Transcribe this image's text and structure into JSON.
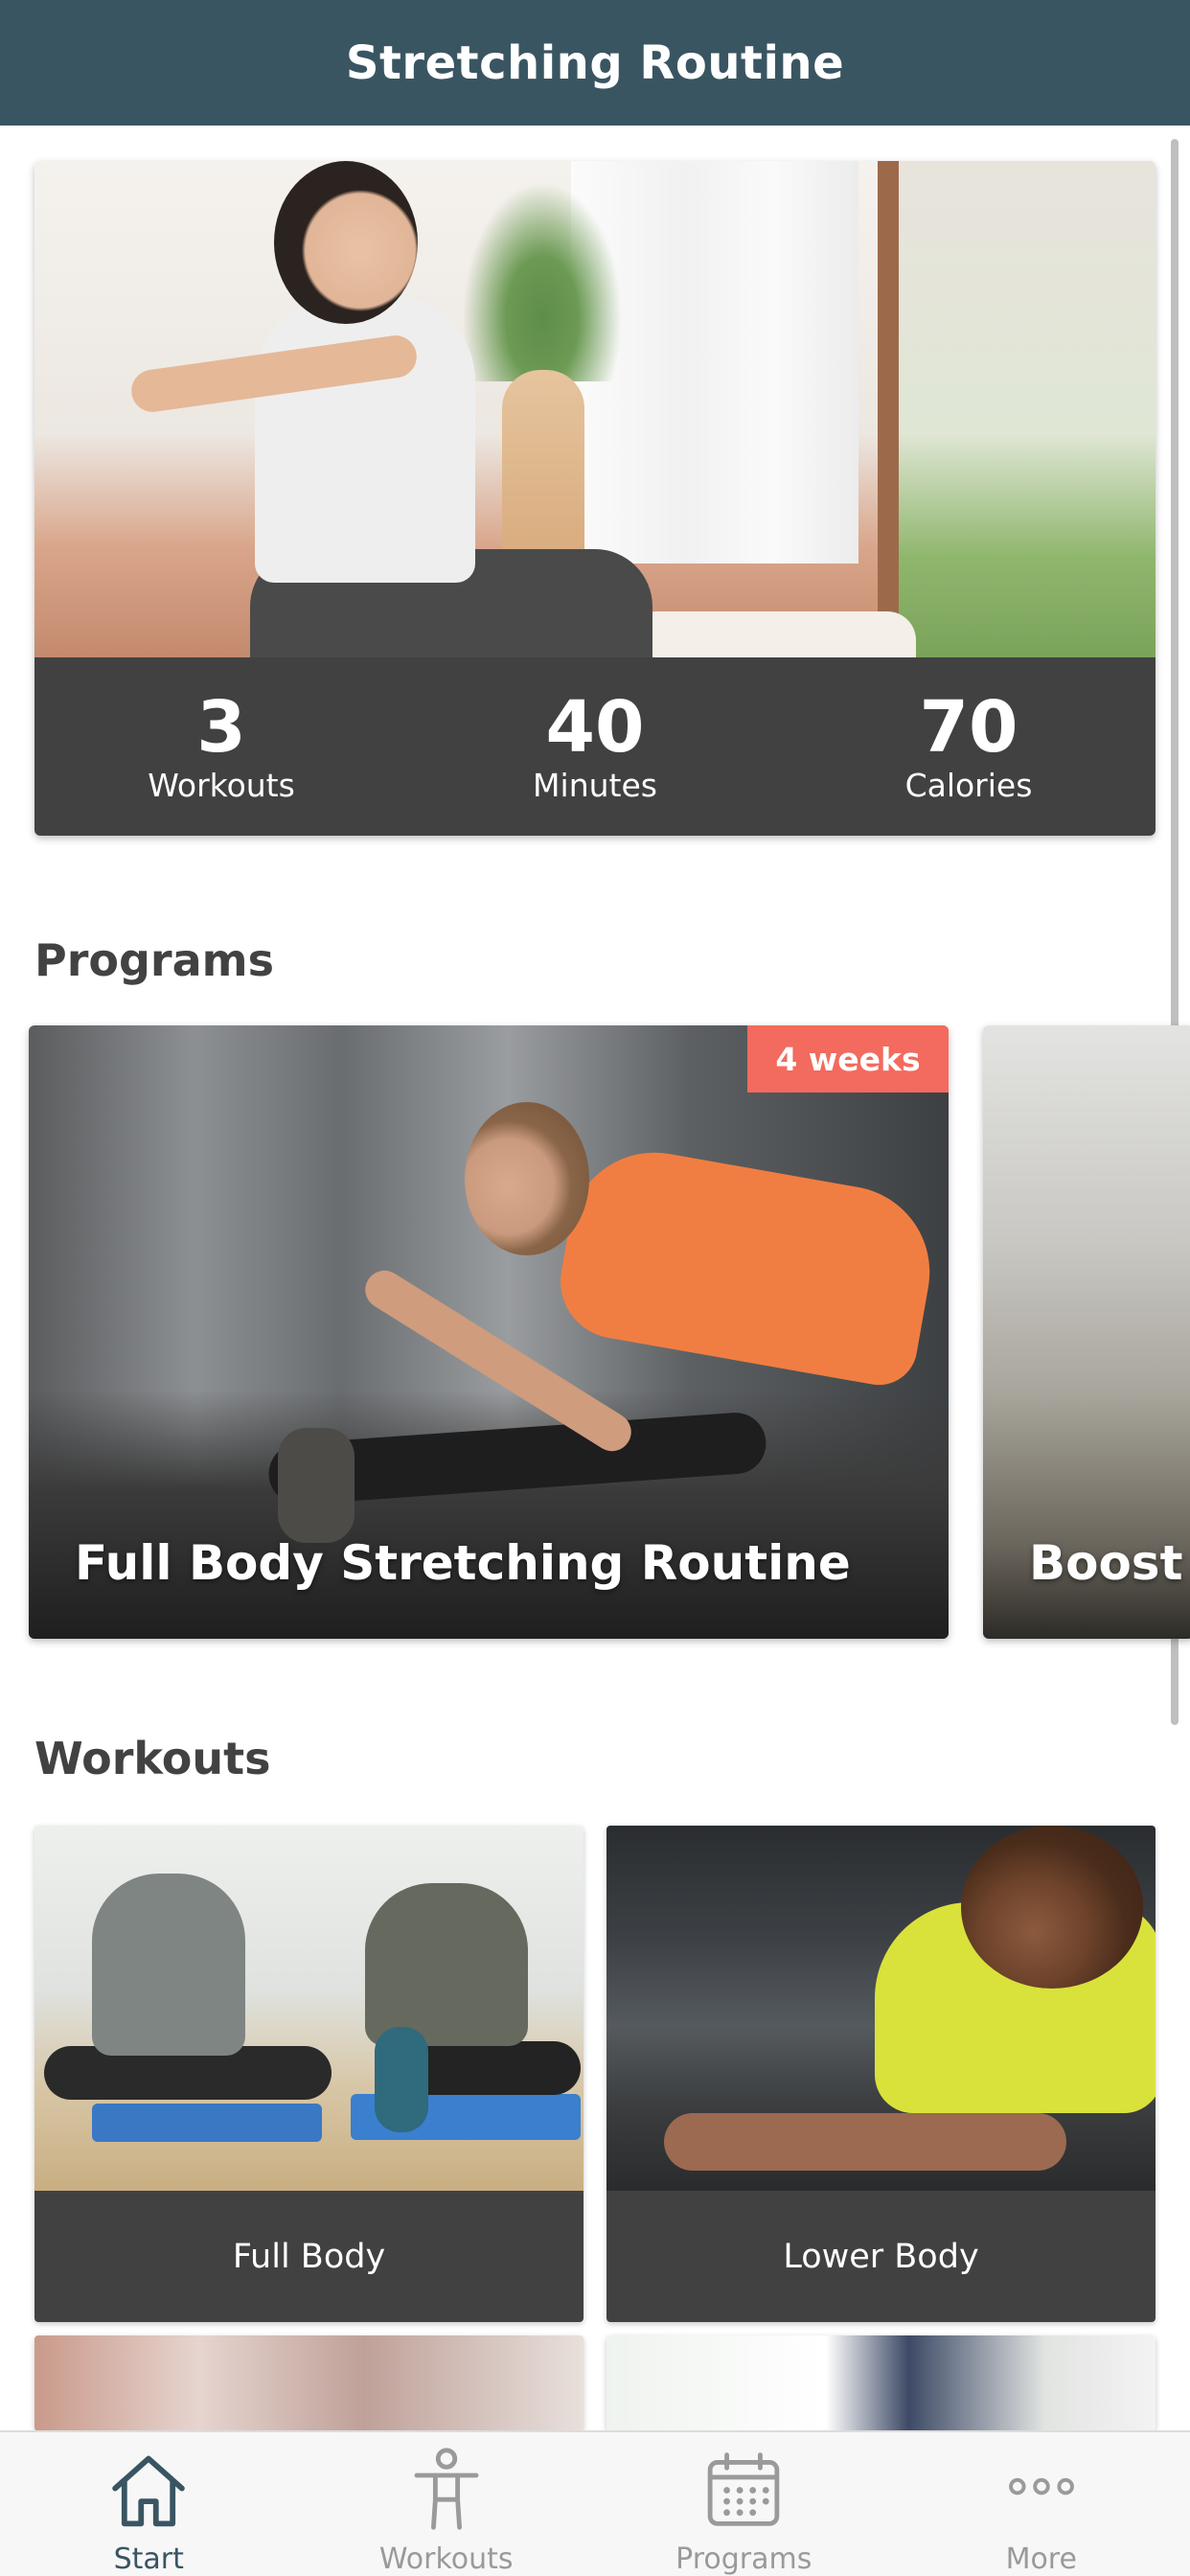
{
  "header": {
    "title": "Stretching Routine"
  },
  "hero": {
    "stats": [
      {
        "value": "3",
        "label": "Workouts"
      },
      {
        "value": "40",
        "label": "Minutes"
      },
      {
        "value": "70",
        "label": "Calories"
      }
    ]
  },
  "programs": {
    "title": "Programs",
    "items": [
      {
        "title": "Full Body Stretching Routine",
        "badge": "4 weeks"
      },
      {
        "title": "Boost y"
      }
    ]
  },
  "workouts": {
    "title": "Workouts",
    "items": [
      {
        "label": "Full Body"
      },
      {
        "label": "Lower Body"
      }
    ]
  },
  "tabbar": {
    "active": "Start",
    "items": [
      {
        "label": "Start",
        "icon": "home-icon"
      },
      {
        "label": "Workouts",
        "icon": "person-icon"
      },
      {
        "label": "Programs",
        "icon": "calendar-icon"
      },
      {
        "label": "More",
        "icon": "more-icon"
      }
    ]
  },
  "colors": {
    "header": "#3a5562",
    "card_caption": "#414141",
    "badge": "#f26b5e",
    "tab_active": "#3a5562",
    "tab_inactive": "#9a9a9a"
  }
}
